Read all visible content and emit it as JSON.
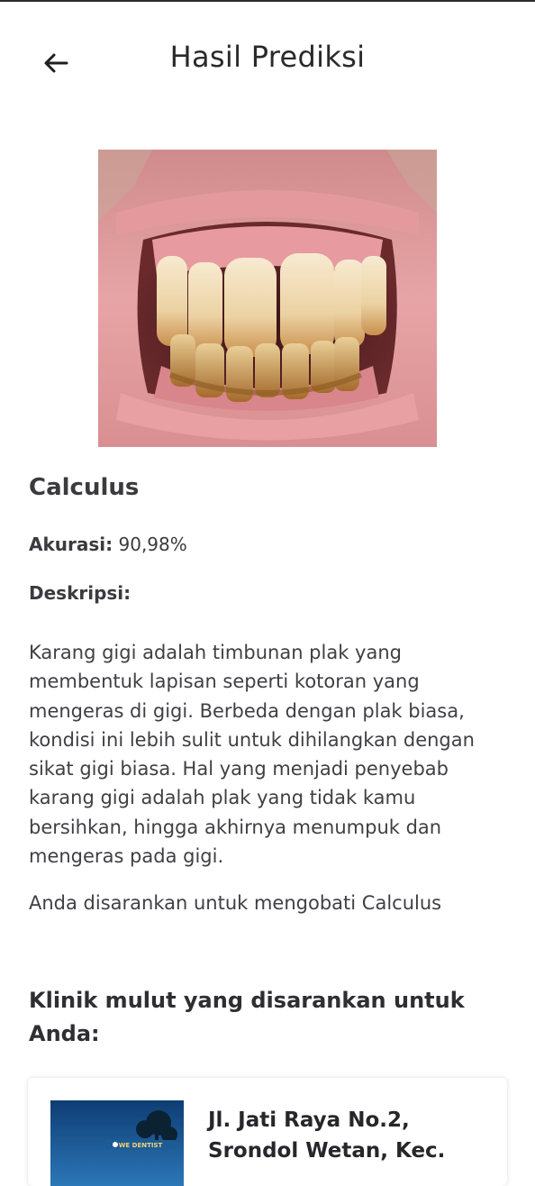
{
  "header": {
    "title": "Hasil Prediksi"
  },
  "result": {
    "disease_name": "Calculus",
    "accuracy_label": "Akurasi:",
    "accuracy_value": "90,98%",
    "description_label": "Deskripsi:",
    "description": "Karang gigi adalah timbunan plak yang membentuk lapisan seperti kotoran yang mengeras di gigi. Berbeda dengan plak biasa, kondisi ini lebih sulit untuk dihilangkan dengan sikat gigi biasa. Hal yang menjadi penyebab karang gigi adalah plak yang tidak kamu bersihkan, hingga akhirnya menumpuk dan mengeras pada gigi.",
    "recommendation": "Anda disarankan untuk mengobati Calculus"
  },
  "clinics": {
    "heading": "Klinik mulut yang disarankan untuk Anda:",
    "items": [
      {
        "address": "Jl. Jati Raya No.2, Srondol Wetan, Kec.",
        "thumb_logo_text": "WE DENTIST"
      }
    ]
  },
  "icons": {
    "back": "arrow-left-icon"
  },
  "colors": {
    "background": "#ffffff",
    "text_primary": "#3a3a3f",
    "card_shadow": "#d8d8d8"
  }
}
